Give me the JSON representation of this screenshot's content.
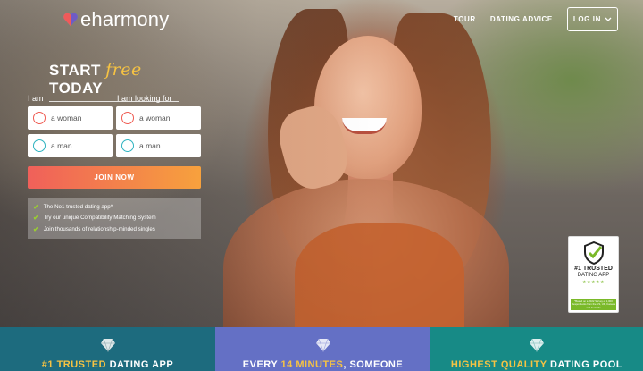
{
  "brand": {
    "logo_text": "eharmony",
    "accent": "#f6c343"
  },
  "nav": {
    "tour": "TOUR",
    "dating_advice": "DATING ADVICE",
    "login": "LOG IN"
  },
  "hero": {
    "headline_start": "START ",
    "headline_free": "free",
    "headline_end": " TODAY",
    "i_am_label": "I am",
    "looking_for_label": "I am looking for",
    "i_am_options": [
      "a woman",
      "a man"
    ],
    "looking_for_options": [
      "a woman",
      "a man"
    ],
    "join_button": "JOIN NOW",
    "bullets": [
      "The No1 trusted dating app*",
      "Try our unique Compatibility Matching System",
      "Join thousands of relationship-minded singles"
    ]
  },
  "badge": {
    "line1": "#1 TRUSTED",
    "line2": "DATING APP",
    "stars": "★★★★★",
    "fine_print": "*Based on a 2022 Survey of 1,000 Respondents from the US, UK, Canada and Australia"
  },
  "strip": [
    {
      "before": "",
      "highlight": "#1 TRUSTED",
      "after": " DATING APP",
      "color": "#1d6b7e"
    },
    {
      "before": "EVERY ",
      "highlight": "14 MINUTES",
      "after": ", SOMEONE",
      "color": "#6470c5"
    },
    {
      "before": "",
      "highlight": "HIGHEST QUALITY",
      "after": " DATING POOL",
      "color": "#178a86"
    }
  ]
}
